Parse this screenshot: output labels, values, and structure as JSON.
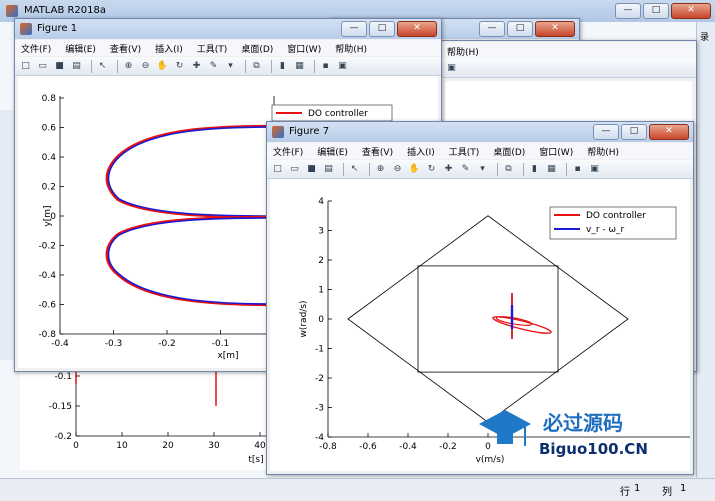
{
  "main_window": {
    "title": "MATLAB R2018a"
  },
  "window_buttons": {
    "minimize": "—",
    "maximize": "□",
    "close": "✕"
  },
  "bg_partial": {
    "help_label": "帮助(H)",
    "right_edge_label": "录"
  },
  "figure1": {
    "title": "Figure 1",
    "menu": [
      "文件(F)",
      "编辑(E)",
      "查看(V)",
      "插入(I)",
      "工具(T)",
      "桌面(D)",
      "窗口(W)",
      "帮助(H)"
    ],
    "legend": [
      "DO controller"
    ],
    "xlabel": "x[m]",
    "ylabel": "y[m]",
    "xticks": [
      "-0.4",
      "-0.3",
      "-0.2",
      "-0.1",
      "0"
    ],
    "yticks": [
      "0.8",
      "0.6",
      "0.4",
      "0.2",
      "0",
      "-0.2",
      "-0.4",
      "-0.6",
      "-0.8"
    ]
  },
  "bg_figure": {
    "xlabel": "t[s]",
    "xticks": [
      "0",
      "10",
      "20",
      "30",
      "40"
    ],
    "yticks": [
      "-0.1",
      "-0.15",
      "-0.2"
    ]
  },
  "figure7": {
    "title": "Figure 7",
    "menu": [
      "文件(F)",
      "编辑(E)",
      "查看(V)",
      "插入(I)",
      "工具(T)",
      "桌面(D)",
      "窗口(W)",
      "帮助(H)"
    ],
    "legend": [
      "DO controller",
      "v_r - ω_r"
    ],
    "xlabel": "v(m/s)",
    "ylabel": "w(rad/s)",
    "xticks": [
      "-0.8",
      "-0.6",
      "-0.4",
      "-0.2",
      "0"
    ],
    "yticks": [
      "4",
      "3",
      "2",
      "1",
      "0",
      "-1",
      "-2",
      "-3",
      "-4"
    ]
  },
  "watermark": {
    "text_cn": "必过源码",
    "text_en": "Biguo100.CN"
  },
  "status": {
    "row_label": "行",
    "row_value": "1",
    "col_label": "列",
    "col_value": "1"
  },
  "colors": {
    "red": "#e81010",
    "blue": "#1a1ad6",
    "titlebar": "#c9d9ee"
  },
  "chart_data": [
    {
      "type": "line",
      "title": "",
      "xlabel": "x[m]",
      "ylabel": "y[m]",
      "xlim": [
        -0.4,
        0.1
      ],
      "ylim": [
        -0.8,
        0.8
      ],
      "series": [
        {
          "name": "DO controller",
          "color": "red",
          "shape": "figure-eight lobes",
          "x": [
            0,
            -0.3,
            0,
            -0.3,
            0
          ],
          "y": [
            0,
            0.3,
            0.6,
            -0.3,
            -0.6
          ]
        }
      ]
    },
    {
      "type": "scatter",
      "title": "",
      "xlabel": "v(m/s)",
      "ylabel": "w(rad/s)",
      "xlim": [
        -0.8,
        0.8
      ],
      "ylim": [
        -4,
        4
      ],
      "series": [
        {
          "name": "DO controller",
          "color": "red",
          "center": [
            0.12,
            0
          ]
        },
        {
          "name": "v_r - ω_r",
          "color": "blue",
          "center": [
            0.12,
            0
          ]
        }
      ],
      "outer_diamond": [
        [
          -0.7,
          0
        ],
        [
          0,
          3.5
        ],
        [
          0.7,
          0
        ],
        [
          0,
          -3.5
        ]
      ],
      "inner_box": {
        "x": [
          -0.35,
          0.35
        ],
        "y": [
          -1.8,
          1.8
        ]
      }
    }
  ]
}
